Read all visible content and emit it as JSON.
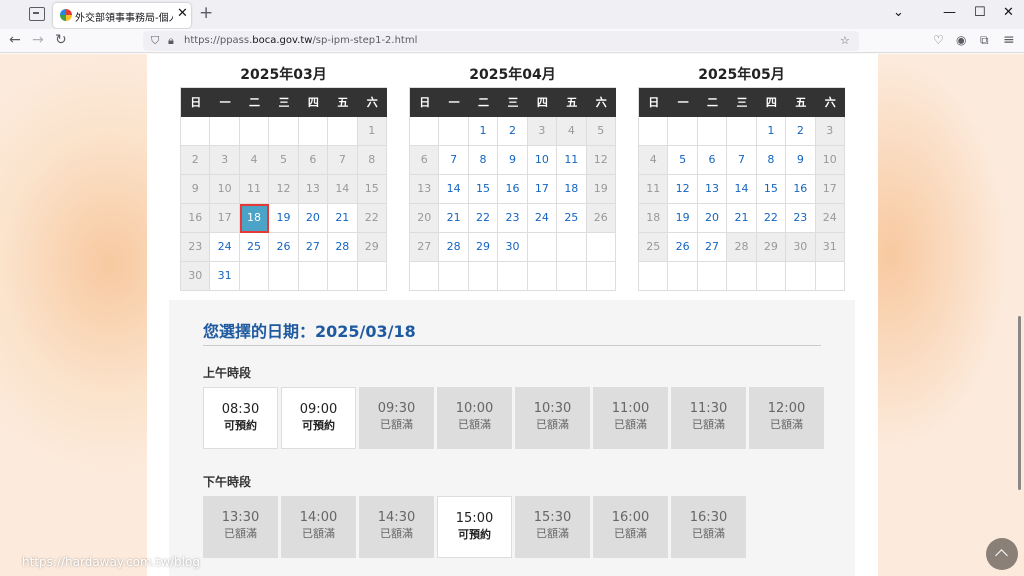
{
  "browser": {
    "tab_title": "外交部領事事務局-個人申辦護",
    "tab_close": "✕",
    "new_tab": "+",
    "url_prefix": "https://ppass.",
    "url_domain": "boca.gov.tw",
    "url_path": "/sp-ipm-step1-2.html"
  },
  "calendars": [
    {
      "title": "2025年03月",
      "weekdays": [
        "日",
        "一",
        "二",
        "三",
        "四",
        "五",
        "六"
      ],
      "weeks": [
        [
          {
            "d": "",
            "k": "empty"
          },
          {
            "d": "",
            "k": "empty"
          },
          {
            "d": "",
            "k": "empty"
          },
          {
            "d": "",
            "k": "empty"
          },
          {
            "d": "",
            "k": "empty"
          },
          {
            "d": "",
            "k": "empty"
          },
          {
            "d": "1",
            "k": "off"
          }
        ],
        [
          {
            "d": "2",
            "k": "off"
          },
          {
            "d": "3",
            "k": "off"
          },
          {
            "d": "4",
            "k": "off"
          },
          {
            "d": "5",
            "k": "off"
          },
          {
            "d": "6",
            "k": "off"
          },
          {
            "d": "7",
            "k": "off"
          },
          {
            "d": "8",
            "k": "off"
          }
        ],
        [
          {
            "d": "9",
            "k": "off"
          },
          {
            "d": "10",
            "k": "off"
          },
          {
            "d": "11",
            "k": "off"
          },
          {
            "d": "12",
            "k": "off"
          },
          {
            "d": "13",
            "k": "off"
          },
          {
            "d": "14",
            "k": "off"
          },
          {
            "d": "15",
            "k": "off"
          }
        ],
        [
          {
            "d": "16",
            "k": "off"
          },
          {
            "d": "17",
            "k": "off"
          },
          {
            "d": "18",
            "k": "sel"
          },
          {
            "d": "19",
            "k": "on"
          },
          {
            "d": "20",
            "k": "on"
          },
          {
            "d": "21",
            "k": "on"
          },
          {
            "d": "22",
            "k": "off"
          }
        ],
        [
          {
            "d": "23",
            "k": "off"
          },
          {
            "d": "24",
            "k": "on"
          },
          {
            "d": "25",
            "k": "on"
          },
          {
            "d": "26",
            "k": "on"
          },
          {
            "d": "27",
            "k": "on"
          },
          {
            "d": "28",
            "k": "on"
          },
          {
            "d": "29",
            "k": "off"
          }
        ],
        [
          {
            "d": "30",
            "k": "off"
          },
          {
            "d": "31",
            "k": "on"
          },
          {
            "d": "",
            "k": "empty"
          },
          {
            "d": "",
            "k": "empty"
          },
          {
            "d": "",
            "k": "empty"
          },
          {
            "d": "",
            "k": "empty"
          },
          {
            "d": "",
            "k": "empty"
          }
        ]
      ]
    },
    {
      "title": "2025年04月",
      "weekdays": [
        "日",
        "一",
        "二",
        "三",
        "四",
        "五",
        "六"
      ],
      "weeks": [
        [
          {
            "d": "",
            "k": "empty"
          },
          {
            "d": "",
            "k": "empty"
          },
          {
            "d": "1",
            "k": "on"
          },
          {
            "d": "2",
            "k": "on"
          },
          {
            "d": "3",
            "k": "off"
          },
          {
            "d": "4",
            "k": "off"
          },
          {
            "d": "5",
            "k": "off"
          }
        ],
        [
          {
            "d": "6",
            "k": "off"
          },
          {
            "d": "7",
            "k": "on"
          },
          {
            "d": "8",
            "k": "on"
          },
          {
            "d": "9",
            "k": "on"
          },
          {
            "d": "10",
            "k": "on"
          },
          {
            "d": "11",
            "k": "on"
          },
          {
            "d": "12",
            "k": "off"
          }
        ],
        [
          {
            "d": "13",
            "k": "off"
          },
          {
            "d": "14",
            "k": "on"
          },
          {
            "d": "15",
            "k": "on"
          },
          {
            "d": "16",
            "k": "on"
          },
          {
            "d": "17",
            "k": "on"
          },
          {
            "d": "18",
            "k": "on"
          },
          {
            "d": "19",
            "k": "off"
          }
        ],
        [
          {
            "d": "20",
            "k": "off"
          },
          {
            "d": "21",
            "k": "on"
          },
          {
            "d": "22",
            "k": "on"
          },
          {
            "d": "23",
            "k": "on"
          },
          {
            "d": "24",
            "k": "on"
          },
          {
            "d": "25",
            "k": "on"
          },
          {
            "d": "26",
            "k": "off"
          }
        ],
        [
          {
            "d": "27",
            "k": "off"
          },
          {
            "d": "28",
            "k": "on"
          },
          {
            "d": "29",
            "k": "on"
          },
          {
            "d": "30",
            "k": "on"
          },
          {
            "d": "",
            "k": "empty"
          },
          {
            "d": "",
            "k": "empty"
          },
          {
            "d": "",
            "k": "empty"
          }
        ],
        [
          {
            "d": "",
            "k": "empty"
          },
          {
            "d": "",
            "k": "empty"
          },
          {
            "d": "",
            "k": "empty"
          },
          {
            "d": "",
            "k": "empty"
          },
          {
            "d": "",
            "k": "empty"
          },
          {
            "d": "",
            "k": "empty"
          },
          {
            "d": "",
            "k": "empty"
          }
        ]
      ]
    },
    {
      "title": "2025年05月",
      "weekdays": [
        "日",
        "一",
        "二",
        "三",
        "四",
        "五",
        "六"
      ],
      "weeks": [
        [
          {
            "d": "",
            "k": "empty"
          },
          {
            "d": "",
            "k": "empty"
          },
          {
            "d": "",
            "k": "empty"
          },
          {
            "d": "",
            "k": "empty"
          },
          {
            "d": "1",
            "k": "on"
          },
          {
            "d": "2",
            "k": "on"
          },
          {
            "d": "3",
            "k": "off"
          }
        ],
        [
          {
            "d": "4",
            "k": "off"
          },
          {
            "d": "5",
            "k": "on"
          },
          {
            "d": "6",
            "k": "on"
          },
          {
            "d": "7",
            "k": "on"
          },
          {
            "d": "8",
            "k": "on"
          },
          {
            "d": "9",
            "k": "on"
          },
          {
            "d": "10",
            "k": "off"
          }
        ],
        [
          {
            "d": "11",
            "k": "off"
          },
          {
            "d": "12",
            "k": "on"
          },
          {
            "d": "13",
            "k": "on"
          },
          {
            "d": "14",
            "k": "on"
          },
          {
            "d": "15",
            "k": "on"
          },
          {
            "d": "16",
            "k": "on"
          },
          {
            "d": "17",
            "k": "off"
          }
        ],
        [
          {
            "d": "18",
            "k": "off"
          },
          {
            "d": "19",
            "k": "on"
          },
          {
            "d": "20",
            "k": "on"
          },
          {
            "d": "21",
            "k": "on"
          },
          {
            "d": "22",
            "k": "on"
          },
          {
            "d": "23",
            "k": "on"
          },
          {
            "d": "24",
            "k": "off"
          }
        ],
        [
          {
            "d": "25",
            "k": "off"
          },
          {
            "d": "26",
            "k": "on"
          },
          {
            "d": "27",
            "k": "on"
          },
          {
            "d": "28",
            "k": "off"
          },
          {
            "d": "29",
            "k": "off"
          },
          {
            "d": "30",
            "k": "off"
          },
          {
            "d": "31",
            "k": "off"
          }
        ],
        [
          {
            "d": "",
            "k": "empty"
          },
          {
            "d": "",
            "k": "empty"
          },
          {
            "d": "",
            "k": "empty"
          },
          {
            "d": "",
            "k": "empty"
          },
          {
            "d": "",
            "k": "empty"
          },
          {
            "d": "",
            "k": "empty"
          },
          {
            "d": "",
            "k": "empty"
          }
        ]
      ]
    }
  ],
  "selection": {
    "label": "您選擇的日期：2025/03/18"
  },
  "morning": {
    "label": "上午時段",
    "slots": [
      {
        "time": "08:30",
        "status": "可預約",
        "free": true
      },
      {
        "time": "09:00",
        "status": "可預約",
        "free": true
      },
      {
        "time": "09:30",
        "status": "已額滿",
        "free": false
      },
      {
        "time": "10:00",
        "status": "已額滿",
        "free": false
      },
      {
        "time": "10:30",
        "status": "已額滿",
        "free": false
      },
      {
        "time": "11:00",
        "status": "已額滿",
        "free": false
      },
      {
        "time": "11:30",
        "status": "已額滿",
        "free": false
      },
      {
        "time": "12:00",
        "status": "已額滿",
        "free": false
      }
    ]
  },
  "afternoon": {
    "label": "下午時段",
    "slots": [
      {
        "time": "13:30",
        "status": "已額滿",
        "free": false
      },
      {
        "time": "14:00",
        "status": "已額滿",
        "free": false
      },
      {
        "time": "14:30",
        "status": "已額滿",
        "free": false
      },
      {
        "time": "15:00",
        "status": "可預約",
        "free": true
      },
      {
        "time": "15:30",
        "status": "已額滿",
        "free": false
      },
      {
        "time": "16:00",
        "status": "已額滿",
        "free": false
      },
      {
        "time": "16:30",
        "status": "已額滿",
        "free": false
      }
    ]
  },
  "watermark": "https://hardaway.com.tw/blog"
}
